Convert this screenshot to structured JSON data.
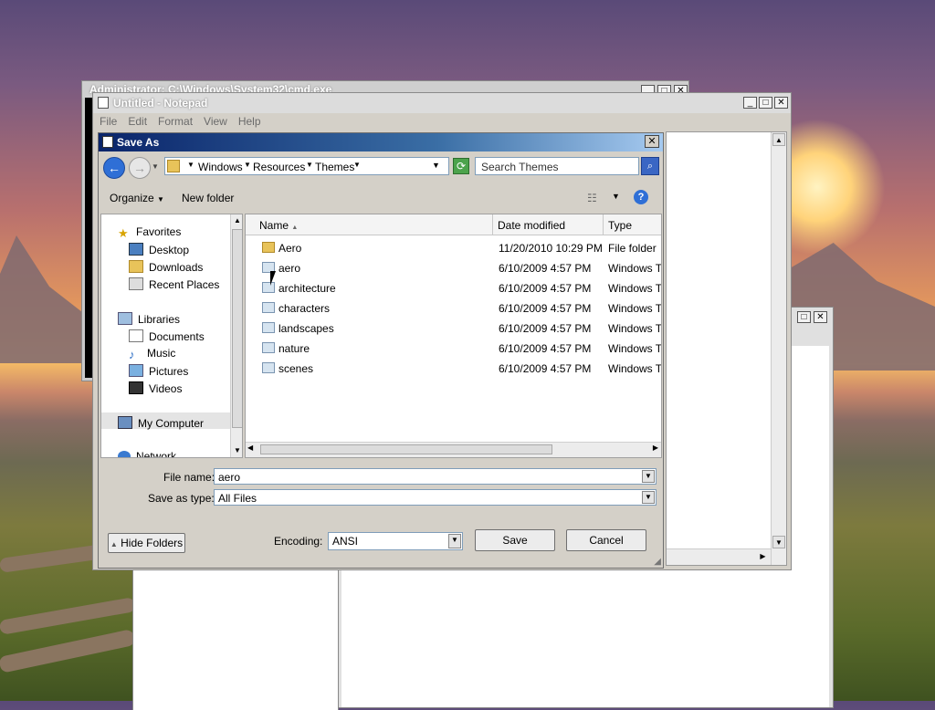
{
  "cmd_window": {
    "title": "Administrator: C:\\Windows\\System32\\cmd.exe"
  },
  "notepad": {
    "title": "Untitled - Notepad",
    "menu": [
      "File",
      "Edit",
      "Format",
      "View",
      "Help"
    ]
  },
  "save_as": {
    "title": "Save As",
    "breadcrumb": [
      "Windows",
      "Resources",
      "Themes"
    ],
    "search_placeholder": "Search Themes",
    "toolbar": {
      "organize": "Organize",
      "new_folder": "New folder"
    },
    "nav": {
      "favorites": "Favorites",
      "desktop": "Desktop",
      "downloads": "Downloads",
      "recent": "Recent Places",
      "libraries": "Libraries",
      "documents": "Documents",
      "music": "Music",
      "pictures": "Pictures",
      "videos": "Videos",
      "computer": "My Computer",
      "network": "Network"
    },
    "columns": {
      "name": "Name",
      "date": "Date modified",
      "type": "Type"
    },
    "files": [
      {
        "name": "Aero",
        "date": "11/20/2010 10:29 PM",
        "type": "File folder",
        "icon": "folder-icon"
      },
      {
        "name": "aero",
        "date": "6/10/2009 4:57 PM",
        "type": "Windows The",
        "icon": "theme-icon"
      },
      {
        "name": "architecture",
        "date": "6/10/2009 4:57 PM",
        "type": "Windows The",
        "icon": "theme-icon"
      },
      {
        "name": "characters",
        "date": "6/10/2009 4:57 PM",
        "type": "Windows The",
        "icon": "theme-icon"
      },
      {
        "name": "landscapes",
        "date": "6/10/2009 4:57 PM",
        "type": "Windows The",
        "icon": "theme-icon"
      },
      {
        "name": "nature",
        "date": "6/10/2009 4:57 PM",
        "type": "Windows The",
        "icon": "theme-icon"
      },
      {
        "name": "scenes",
        "date": "6/10/2009 4:57 PM",
        "type": "Windows The",
        "icon": "theme-icon"
      }
    ],
    "file_name_label": "File name:",
    "file_name_value": "aero",
    "save_type_label": "Save as type:",
    "save_type_value": "All Files",
    "hide_folders": "Hide Folders",
    "encoding_label": "Encoding:",
    "encoding_value": "ANSI",
    "save_button": "Save",
    "cancel_button": "Cancel"
  }
}
